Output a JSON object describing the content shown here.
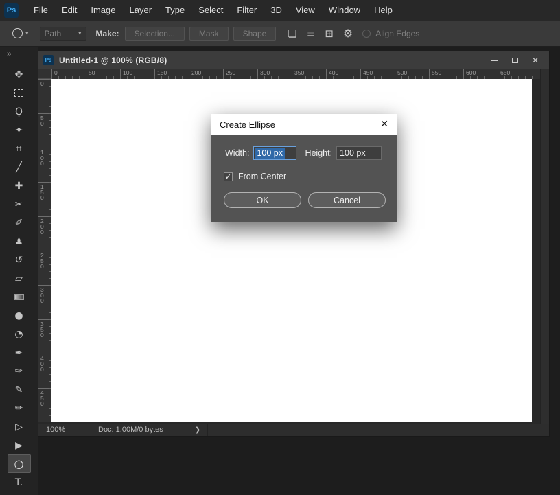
{
  "app": {
    "logo": "Ps",
    "accent_blue": "#31a8ff",
    "selection_blue": "#3069a8",
    "dialog_gray": "#535353",
    "canvas_white": "#ffffff"
  },
  "menubar": {
    "items": [
      "File",
      "Edit",
      "Image",
      "Layer",
      "Type",
      "Select",
      "Filter",
      "3D",
      "View",
      "Window",
      "Help"
    ]
  },
  "options_bar": {
    "tool_mode_value": "Path",
    "make_label": "Make:",
    "make_buttons": [
      "Selection...",
      "Mask",
      "Shape"
    ],
    "icons": {
      "path_ops": "❏",
      "path_align": "≡",
      "path_arrange": "⊞",
      "gear": "⚙"
    },
    "caret_glyph": "▾",
    "align_edges_label": "Align Edges"
  },
  "toolbar": {
    "expand_glyph": "»",
    "tools": [
      {
        "name": "move",
        "glyph": "✥"
      },
      {
        "name": "rectangular-marquee",
        "glyph": ""
      },
      {
        "name": "lasso",
        "glyph": "Ϙ"
      },
      {
        "name": "quick-selection",
        "glyph": "✦"
      },
      {
        "name": "crop",
        "glyph": "⌗"
      },
      {
        "name": "ruler",
        "glyph": "╱"
      },
      {
        "name": "spot-healing",
        "glyph": "✚"
      },
      {
        "name": "content-aware-move",
        "glyph": "✂"
      },
      {
        "name": "brush",
        "glyph": "✐"
      },
      {
        "name": "clone-stamp",
        "glyph": "♟"
      },
      {
        "name": "history-brush",
        "glyph": "↺"
      },
      {
        "name": "eraser",
        "glyph": "▱"
      },
      {
        "name": "gradient",
        "glyph": ""
      },
      {
        "name": "blur",
        "glyph": "●"
      },
      {
        "name": "dodge",
        "glyph": "◔"
      },
      {
        "name": "pen",
        "glyph": "✒"
      },
      {
        "name": "freeform-pen",
        "glyph": "✑"
      },
      {
        "name": "add-anchor-pen",
        "glyph": "✎"
      },
      {
        "name": "convert-point",
        "glyph": "✏"
      },
      {
        "name": "path-selection",
        "glyph": "▷"
      },
      {
        "name": "direct-selection",
        "glyph": "▶"
      },
      {
        "name": "ellipse",
        "glyph": "○",
        "selected": true
      },
      {
        "name": "type",
        "glyph": "T."
      }
    ]
  },
  "document": {
    "title": "Untitled-1 @ 100% (RGB/8)",
    "close_glyph": "✕",
    "ruler_h": [
      "0",
      "50",
      "100",
      "150",
      "200",
      "250",
      "300",
      "350",
      "400",
      "450",
      "500",
      "550",
      "600",
      "650"
    ],
    "ruler_v": [
      "0",
      "50",
      "100",
      "150",
      "200",
      "250",
      "300",
      "350",
      "400",
      "450"
    ],
    "status_zoom": "100%",
    "status_doc": "Doc: 1.00M/0 bytes",
    "status_chevron": "❯"
  },
  "dialog": {
    "title": "Create Ellipse",
    "close_glyph": "✕",
    "width_label": "Width:",
    "width_value": "100 px",
    "height_label": "Height:",
    "height_value": "100 px",
    "from_center_label": "From Center",
    "check_glyph": "✓",
    "ok_label": "OK",
    "cancel_label": "Cancel"
  }
}
